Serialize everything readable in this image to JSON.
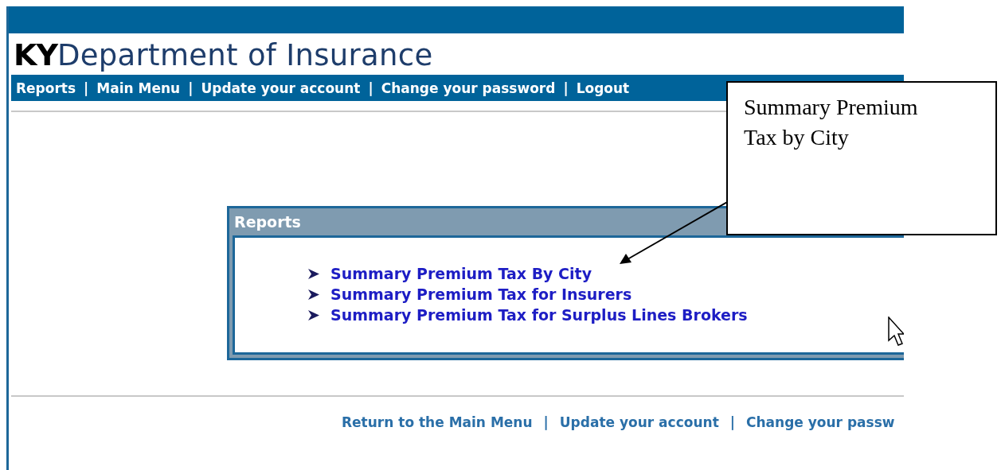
{
  "header": {
    "prefix": "KY",
    "title": "Department of Insurance"
  },
  "nav": {
    "separator": "|",
    "items": [
      "Reports",
      "Main Menu",
      "Update your account",
      "Change your password",
      "Logout"
    ]
  },
  "panel": {
    "title": "Reports",
    "links": [
      "Summary Premium Tax By City",
      "Summary Premium Tax for Insurers",
      "Summary Premium Tax for Surplus Lines Brokers"
    ]
  },
  "footer": {
    "separator": "|",
    "items": [
      "Return to the Main Menu",
      "Update your account",
      "Change your passw"
    ]
  },
  "callout": {
    "text": "Summary Premium Tax by City"
  }
}
